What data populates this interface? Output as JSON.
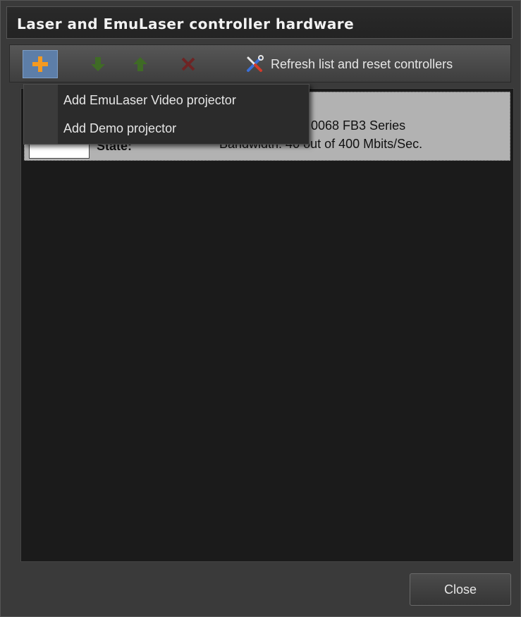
{
  "window": {
    "title": "Laser and EmuLaser controller hardware"
  },
  "toolbar": {
    "add_icon": "plus-icon",
    "move_down_icon": "arrow-down-icon",
    "move_up_icon": "arrow-up-icon",
    "remove_icon": "x-icon",
    "refresh_icon": "tools-icon",
    "refresh_label": "Refresh list and reset controllers"
  },
  "device": {
    "model": "0068 FB3 Series",
    "state_label": "State:",
    "bandwidth": "Bandwidth: 40 out of 400 Mbits/Sec."
  },
  "add_menu": {
    "items": [
      "Add EmuLaser Video projector",
      "Add Demo projector"
    ]
  },
  "footer": {
    "close_label": "Close"
  },
  "colors": {
    "add_highlight": "#5d7ea8",
    "plus_icon": "#f59a20",
    "arrow_icon": "#4a7a2a",
    "remove_icon": "#7a2a2a"
  }
}
